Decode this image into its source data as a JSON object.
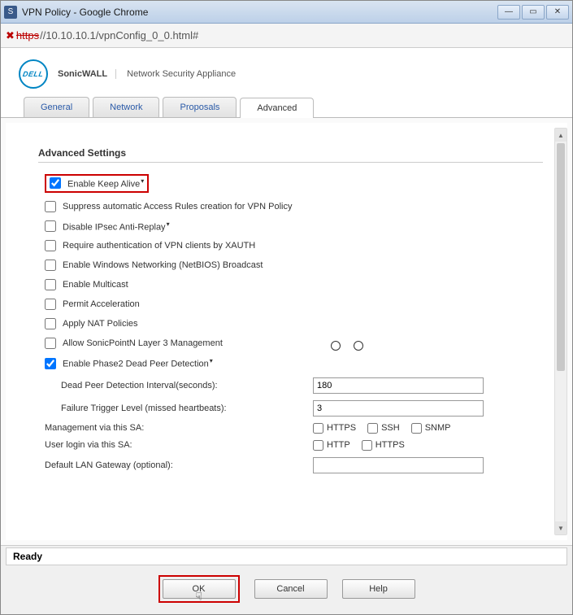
{
  "window": {
    "title": "VPN Policy - Google Chrome"
  },
  "address": {
    "scheme_struck": "https",
    "url": "//10.10.10.1/vpnConfig_0_0.html#"
  },
  "brand": {
    "logo": "DELL",
    "product": "SonicWALL",
    "subtitle": "Network Security Appliance"
  },
  "tabs": [
    {
      "label": "General"
    },
    {
      "label": "Network"
    },
    {
      "label": "Proposals"
    },
    {
      "label": "Advanced"
    }
  ],
  "section_title": "Advanced Settings",
  "checks": {
    "keepalive": "Enable Keep Alive",
    "suppress": "Suppress automatic Access Rules creation for VPN Policy",
    "antireplay": "Disable IPsec Anti-Replay",
    "xauth": "Require authentication of VPN clients by XAUTH",
    "netbios": "Enable Windows Networking (NetBIOS) Broadcast",
    "multicast": "Enable Multicast",
    "permitaccel": "Permit Acceleration",
    "nat": "Apply NAT Policies",
    "sonicpoint": "Allow SonicPointN Layer 3 Management",
    "dpd": "Enable Phase2 Dead Peer Detection"
  },
  "dpd_fields": {
    "interval_label": "Dead Peer Detection Interval(seconds):",
    "interval_value": "180",
    "failure_label": "Failure Trigger Level (missed heartbeats):",
    "failure_value": "3"
  },
  "mgmt": {
    "sa_label": "Management via this SA:",
    "sa_opts": [
      "HTTPS",
      "SSH",
      "SNMP"
    ],
    "user_label": "User login via this SA:",
    "user_opts": [
      "HTTP",
      "HTTPS"
    ],
    "gateway_label": "Default LAN Gateway (optional):",
    "gateway_value": ""
  },
  "status": "Ready",
  "buttons": {
    "ok": "OK",
    "cancel": "Cancel",
    "help": "Help"
  }
}
